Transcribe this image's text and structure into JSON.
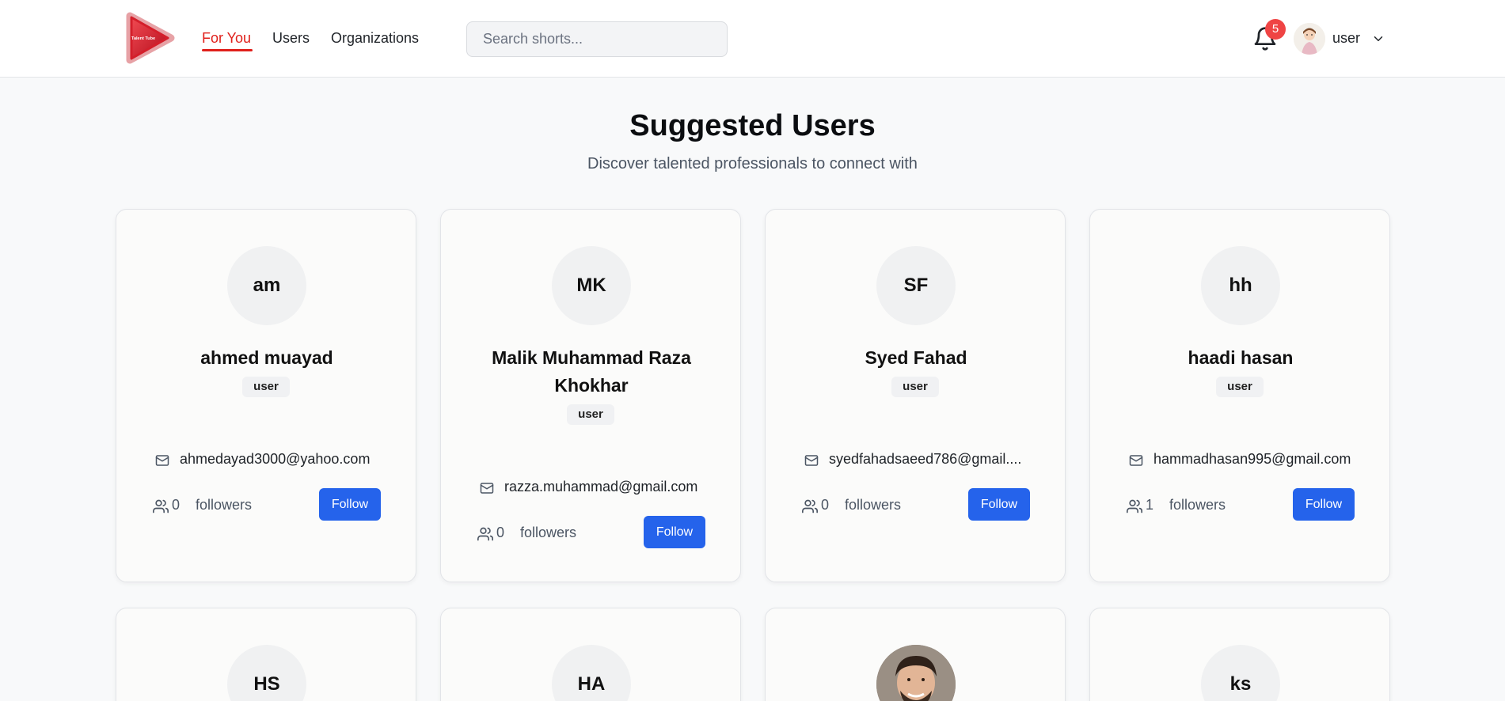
{
  "header": {
    "logo_text": "Talent Tube",
    "nav": [
      {
        "label": "For You"
      },
      {
        "label": "Users"
      },
      {
        "label": "Organizations"
      }
    ],
    "search": {
      "placeholder": "Search shorts..."
    },
    "notifications": {
      "count": "5"
    },
    "user_name": "user"
  },
  "hero": {
    "title": "Suggested Users",
    "subtitle": "Discover talented professionals to connect with"
  },
  "cards": [
    {
      "initials": "am",
      "name": "ahmed muayad",
      "role": "user",
      "email": "ahmedayad3000@yahoo.com",
      "followers": "0",
      "followers_label": "followers",
      "follow_label": "Follow"
    },
    {
      "initials": "MK",
      "name": "Malik Muhammad Raza Khokhar",
      "role": "user",
      "email": "razza.muhammad@gmail.com",
      "followers": "0",
      "followers_label": "followers",
      "follow_label": "Follow"
    },
    {
      "initials": "SF",
      "name": "Syed Fahad",
      "role": "user",
      "email": "syedfahadsaeed786@gmail....",
      "followers": "0",
      "followers_label": "followers",
      "follow_label": "Follow"
    },
    {
      "initials": "hh",
      "name": "haadi hasan",
      "role": "user",
      "email": "hammadhasan995@gmail.com",
      "followers": "1",
      "followers_label": "followers",
      "follow_label": "Follow"
    },
    {
      "initials": "HS"
    },
    {
      "initials": "HA"
    },
    {
      "initials": ""
    },
    {
      "initials": "ks"
    }
  ],
  "colors": {
    "accent_red": "#e0201b",
    "button_blue": "#2563eb",
    "badge_red": "#ef4444"
  }
}
